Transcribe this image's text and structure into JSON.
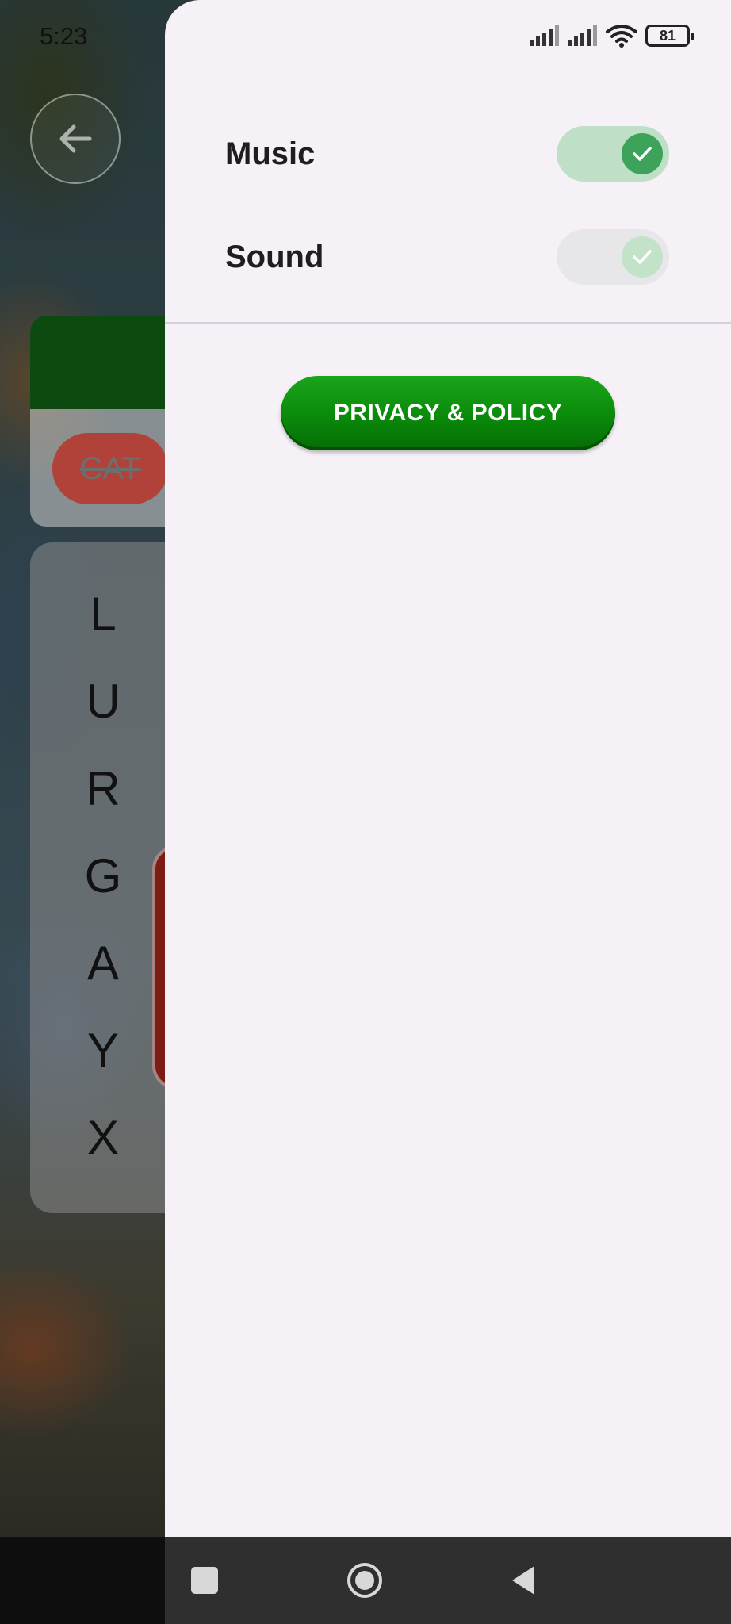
{
  "status_bar": {
    "time": "5:23",
    "battery": "81",
    "icons": [
      "signal-icon",
      "signal-icon",
      "wifi-icon",
      "battery-icon"
    ]
  },
  "background_game": {
    "back_icon": "arrow-left-icon",
    "found_word": "CAT",
    "letters": [
      "L",
      "U",
      "R",
      "G",
      "A",
      "Y",
      "X"
    ]
  },
  "drawer": {
    "settings": [
      {
        "label": "Music",
        "enabled": true
      },
      {
        "label": "Sound",
        "enabled": true
      }
    ],
    "privacy_button": "PRIVACY & POLICY"
  },
  "nav_bar": {
    "buttons": [
      "recent-apps-icon",
      "home-icon",
      "back-icon"
    ]
  },
  "colors": {
    "accent_green": "#0a8a0a",
    "toggle_on_track": "#bfe0c6",
    "toggle_on_knob": "#3da35a",
    "drawer_bg": "#f5f1f7"
  }
}
